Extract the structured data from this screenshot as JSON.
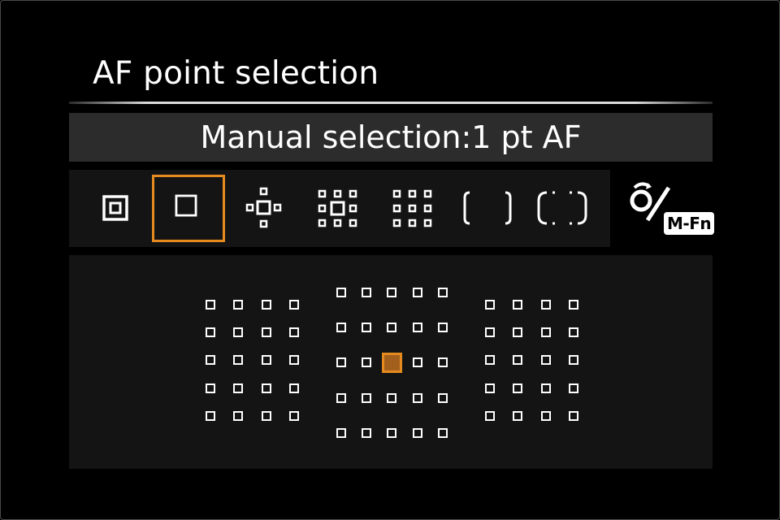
{
  "screen": {
    "title": "AF point selection",
    "mode_label": "Manual selection:1 pt AF"
  },
  "modes": [
    {
      "id": "spot-af",
      "icon": "spot-af-icon",
      "selected": false
    },
    {
      "id": "single-point-af",
      "icon": "single-point-af-icon",
      "selected": true
    },
    {
      "id": "zone-expand-cross",
      "icon": "expand-af-cross-icon",
      "selected": false
    },
    {
      "id": "zone-expand-surround",
      "icon": "expand-af-surround-icon",
      "selected": false
    },
    {
      "id": "zone-af",
      "icon": "zone-af-icon",
      "selected": false
    },
    {
      "id": "large-zone-af",
      "icon": "large-zone-af-icon",
      "selected": false
    },
    {
      "id": "auto-selection-af",
      "icon": "auto-selection-af-icon",
      "selected": false
    }
  ],
  "mfn_button": {
    "label": "M-Fn",
    "icon": "dial-mfn-icon"
  },
  "af_grid": {
    "selected_group": "center",
    "selected_row": 3,
    "selected_col": 3,
    "left_group": {
      "columns": 4,
      "rows": 5
    },
    "center_group": {
      "columns": 5,
      "rows": 5
    },
    "right_group": {
      "columns": 4,
      "rows": 5
    }
  },
  "colors": {
    "accent": "#e58a1f",
    "active_fill": "#a3601c",
    "panel": "#141414",
    "bar": "#2c2c2c"
  }
}
